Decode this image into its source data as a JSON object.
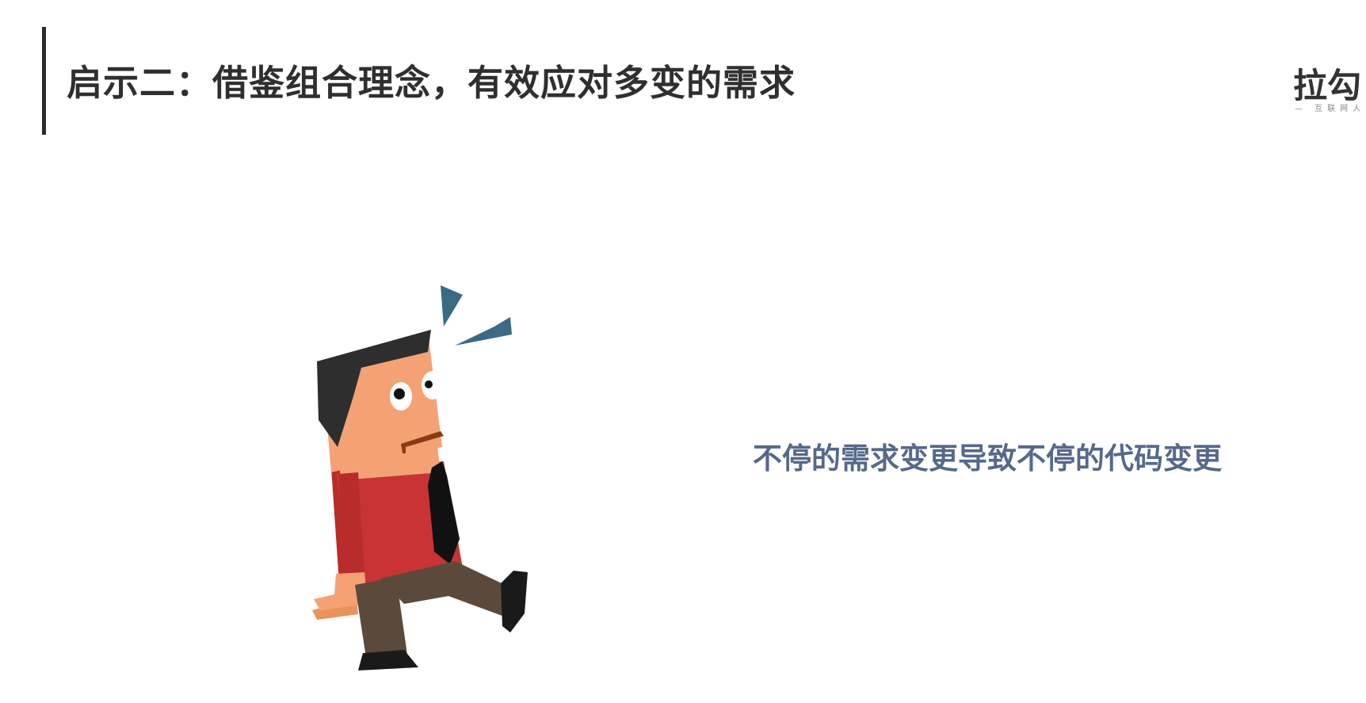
{
  "slide": {
    "title": "启示二：借鉴组合理念，有效应对多变的需求",
    "caption": "不停的需求变更导致不停的代码变更"
  },
  "logo": {
    "text": "拉勾",
    "tagline": "— 互联网人"
  },
  "illustration": {
    "icon": "surprised-man-walking",
    "colors": {
      "skin": "#f4a274",
      "hair": "#2e2e2e",
      "shirt": "#c93333",
      "tie": "#111111",
      "pants": "#5b4a3c",
      "shoes": "#1a1a1a",
      "alert_marks": "#3a6b84",
      "mouth": "#8a3a14"
    }
  },
  "theme": {
    "title_color": "#2f2f2f",
    "caption_color": "#56698a",
    "bar_color": "#2b2b2b"
  }
}
